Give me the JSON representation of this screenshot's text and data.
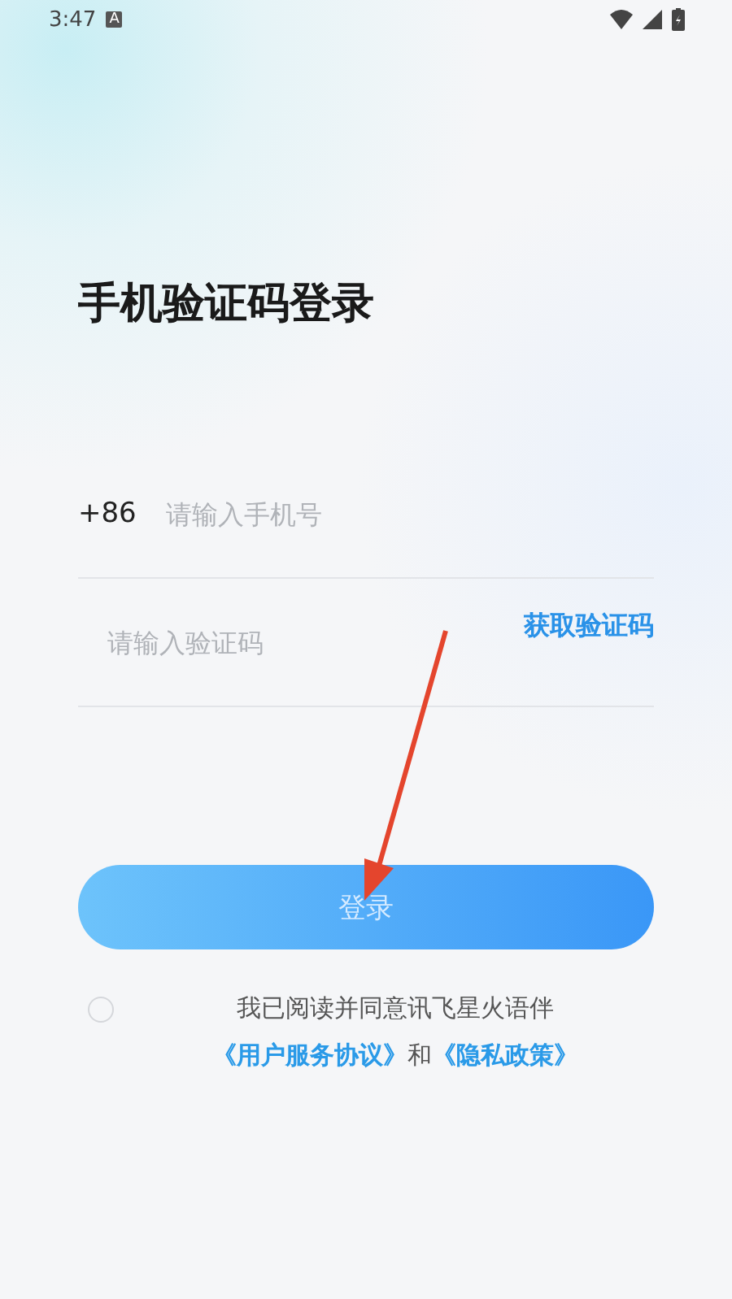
{
  "status_bar": {
    "time": "3:47",
    "notification": "A"
  },
  "title": "手机验证码登录",
  "phone": {
    "prefix": "+86",
    "placeholder": "请输入手机号"
  },
  "code": {
    "placeholder": "请输入验证码",
    "action": "获取验证码"
  },
  "login_button": {
    "label": "登录",
    "disabled": true
  },
  "agreement": {
    "checked": false,
    "text": "我已阅读并同意讯飞星火语伴",
    "link_1": "《用户服务协议》",
    "joiner": "和",
    "link_2": "《隐私政策》"
  },
  "annotation": {
    "kind": "arrow"
  }
}
